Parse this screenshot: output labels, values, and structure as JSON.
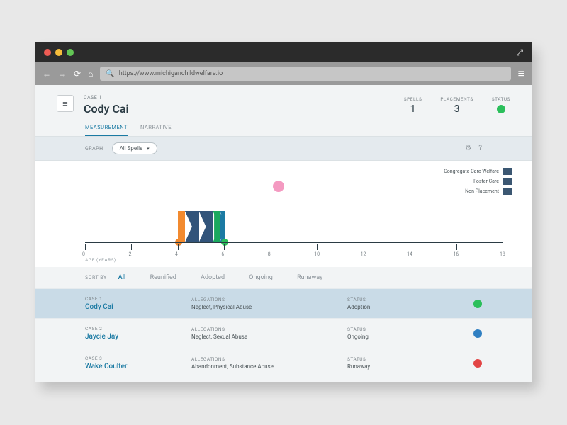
{
  "browser": {
    "url": "https://www.michiganchildwelfare.io"
  },
  "case": {
    "eyebrow": "CASE 1",
    "name": "Cody Cai",
    "spells_label": "SPELLS",
    "spells": "1",
    "placements_label": "PLACEMENTS",
    "placements": "3",
    "status_label": "STATUS",
    "status_color": "#2bbf5b"
  },
  "tabs": {
    "measurement": "MEASUREMENT",
    "narrative": "NARRATIVE"
  },
  "graph": {
    "label": "GRAPH",
    "dropdown": "All Spells",
    "axis_label": "AGE (YEARS)",
    "legend": [
      "Congregate Care Welfare",
      "Foster Care",
      "Non Placement"
    ]
  },
  "chart_data": {
    "type": "bar",
    "title": "",
    "xlabel": "AGE (YEARS)",
    "ylabel": "",
    "xlim": [
      0,
      18
    ],
    "ticks": [
      0,
      2,
      4,
      6,
      8,
      10,
      12,
      14,
      16,
      18
    ],
    "spells": [
      {
        "start_age": 4.0,
        "end_age": 6.0,
        "end_marker_color": "#2bbf5b",
        "start_marker_color": "#f28a2f",
        "placements": [
          {
            "type": "Foster Care",
            "color": "#f28a2f",
            "from": 4.0,
            "to": 4.3
          },
          {
            "type": "Congregate Care Welfare",
            "color": "#32547a",
            "from": 4.3,
            "to": 4.9
          },
          {
            "type": "Congregate Care Welfare",
            "color": "#32547a",
            "from": 4.9,
            "to": 5.5
          },
          {
            "type": "Non Placement",
            "color": "#1aa85e",
            "from": 5.5,
            "to": 5.8
          },
          {
            "type": "Foster Care",
            "color": "#1b7aa3",
            "from": 5.8,
            "to": 6.0
          }
        ]
      }
    ],
    "annotation_marker": {
      "age": 8.3,
      "color": "#f49ac1"
    }
  },
  "sort": {
    "label": "SORT BY",
    "options": [
      "All",
      "Reunified",
      "Adopted",
      "Ongoing",
      "Runaway"
    ],
    "active": "All"
  },
  "list": [
    {
      "case": "CASE 1",
      "name": "Cody Cai",
      "alleg_label": "ALLEGATIONS",
      "alleg": "Neglect, Physical Abuse",
      "status_label": "STATUS",
      "status": "Adoption",
      "color": "#2bbf5b",
      "selected": true
    },
    {
      "case": "CASE 2",
      "name": "Jaycie Jay",
      "alleg_label": "ALLEGATIONS",
      "alleg": "Neglect, Sexual Abuse",
      "status_label": "STATUS",
      "status": "Ongoing",
      "color": "#2f7fc2",
      "selected": false
    },
    {
      "case": "CASE 3",
      "name": "Wake Coulter",
      "alleg_label": "ALLEGATIONS",
      "alleg": "Abandonment, Substance Abuse",
      "status_label": "STATUS",
      "status": "Runaway",
      "color": "#e24444",
      "selected": false
    }
  ]
}
